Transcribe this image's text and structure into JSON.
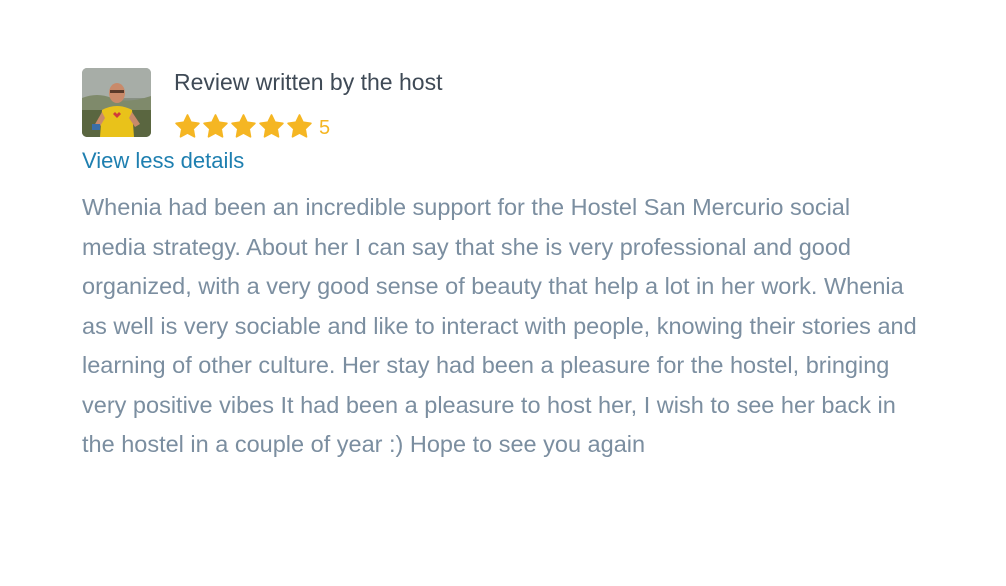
{
  "review": {
    "title": "Review written by the host",
    "rating_value": "5",
    "rating_stars": 5,
    "toggle_label": "View less details",
    "body": "Whenia had been an incredible support for the Hostel San Mercurio social media strategy. About her I can say that she is very professional and good organized, with a very good sense of beauty that help a lot in her work. Whenia as well is very sociable and like to interact with people, knowing their stories and learning of other culture. Her stay had been a pleasure for the hostel, bringing very positive vibes It had been a pleasure to host her, I wish to see her back in the hostel in a couple of year :) Hope to see you again",
    "star_icon": "star-icon",
    "avatar_icon": "avatar"
  },
  "colors": {
    "title": "#3f4a56",
    "star": "#f5b623",
    "link": "#1e7fb0",
    "body": "#7b8ea0"
  }
}
